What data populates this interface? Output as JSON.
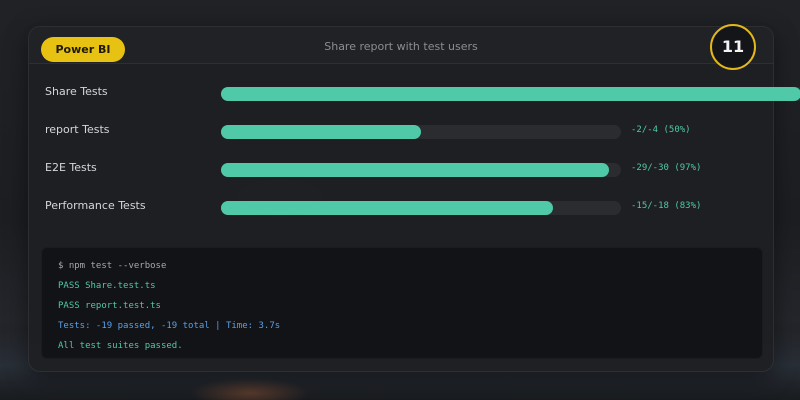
{
  "header": {
    "app_name": "Power BI",
    "title": "Share report with test users",
    "badge_count": "11"
  },
  "suites": [
    {
      "label": "Share Tests",
      "count_text": "",
      "progress": 1.45
    },
    {
      "label": "report Tests",
      "count_text": "-2/-4 (50%)",
      "progress": 0.5
    },
    {
      "label": "E2E Tests",
      "count_text": "-29/-30 (97%)",
      "progress": 0.97
    },
    {
      "label": "Performance Tests",
      "count_text": "-15/-18 (83%)",
      "progress": 0.83
    }
  ],
  "terminal": {
    "command": "$ npm test --verbose",
    "lines": [
      "PASS Share.test.ts",
      "PASS report.test.ts"
    ],
    "summary": "Tests: -19 passed, -19 total | Time: 3.7s",
    "result": "All test suites passed."
  },
  "colors": {
    "accent": "#4fc9a8",
    "brand": "#e8c213",
    "summary": "#5aa0e6"
  }
}
